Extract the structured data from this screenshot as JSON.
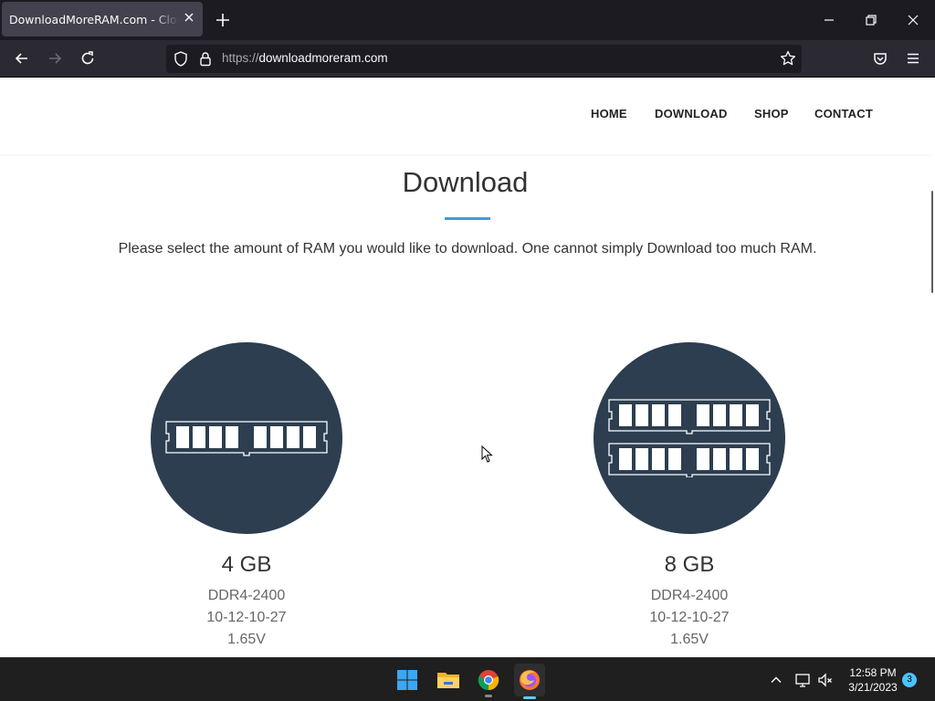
{
  "browser": {
    "tab_title": "DownloadMoreRAM.com - CloudRAM",
    "url_protocol": "https://",
    "url_host": "downloadmoreram.com"
  },
  "site": {
    "nav": [
      "HOME",
      "DOWNLOAD",
      "SHOP",
      "CONTACT"
    ],
    "heading": "Download",
    "accent_color": "#3aa0d6",
    "circle_color": "#2c3e50",
    "lead": "Please select the amount of RAM you would like to download. One cannot simply Download too much RAM.",
    "products": [
      {
        "title": "4 GB",
        "specs": [
          "DDR4-2400",
          "10-12-10-27",
          "1.65V"
        ],
        "icon": "ram-stick-icon"
      },
      {
        "title": "8 GB",
        "specs": [
          "DDR4-2400",
          "10-12-10-27",
          "1.65V"
        ],
        "icon": "ram-two-sticks-icon"
      }
    ]
  },
  "taskbar": {
    "apps": [
      "windows-start-icon",
      "file-explorer-icon",
      "chrome-icon",
      "firefox-icon"
    ],
    "time": "12:58 PM",
    "date": "3/21/2023",
    "notifications": "3"
  }
}
